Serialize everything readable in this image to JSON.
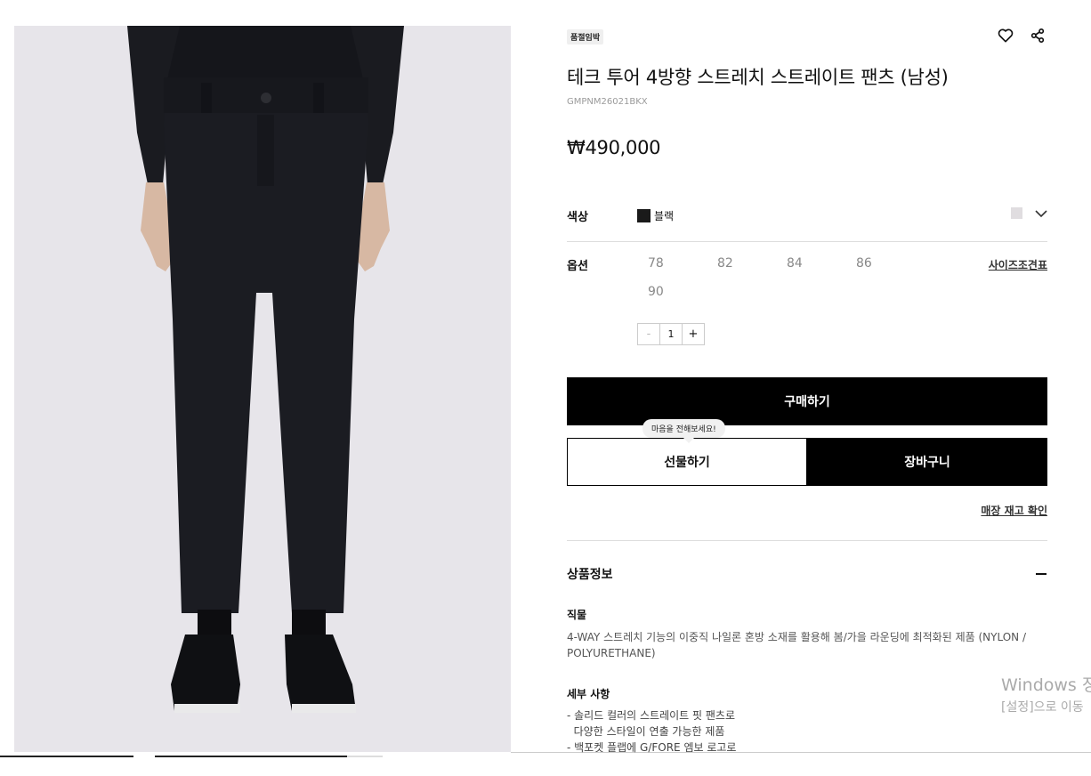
{
  "product": {
    "badge": "품절임박",
    "title": "테크 투어 4방향 스트레치 스트레이트 팬츠 (남성)",
    "code": "GMPNM26021BKX",
    "price": "₩490,000"
  },
  "icons": {
    "wishlist": "heart-icon",
    "share": "share-icon"
  },
  "color": {
    "label": "색상",
    "selected": "블랙",
    "swatch": "#1a1a1a"
  },
  "options": {
    "label": "옵션",
    "sizes": [
      "78",
      "82",
      "84",
      "86",
      "90"
    ],
    "size_guide": "사이즈조견표"
  },
  "quantity": {
    "value": "1",
    "minus": "-",
    "plus": "+"
  },
  "buttons": {
    "buy": "구매하기",
    "gift": "선물하기",
    "cart": "장바구니",
    "gift_tooltip": "마음을 전해보세요!",
    "store_stock": "매장 재고 확인"
  },
  "info": {
    "section_title": "상품정보",
    "material_title": "직물",
    "material_text": "4-WAY 스트레치 기능의 이중직 나일론 혼방 소재를 활용해 봄/가을 라운딩에 최적화된 제품 (NYLON / POLYURETHANE)",
    "details_title": "세부 사항",
    "details": [
      "- 솔리드 컬러의 스트레이트 핏 팬츠로",
      "  다양한 스타일이 연출 가능한 제품",
      "- 백포켓 플랩에 G/FORE 엠보 로고로"
    ]
  },
  "watermark": {
    "line1": "Windows 정",
    "line2": "[설정]으로 이동"
  }
}
